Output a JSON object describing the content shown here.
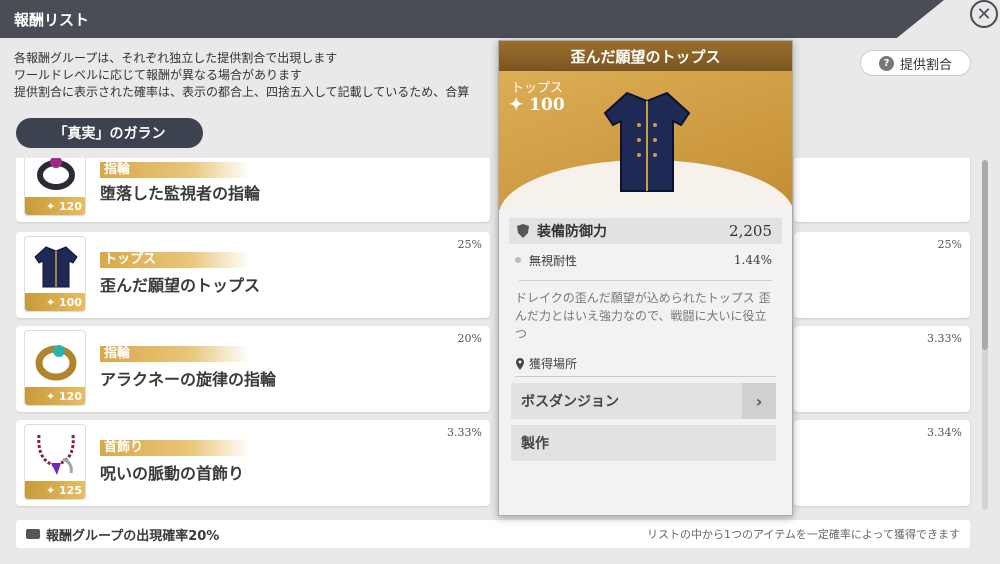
{
  "header": {
    "title": "報酬リスト"
  },
  "notice": {
    "line1": "各報酬グループは、それぞれ独立した提供割合で出現します",
    "line2": "ワールドレベルに応じて報酬が異なる場合があります",
    "line3": "提供割合に表示された確率は、表示の都合上、四捨五入して記載しているため、合算"
  },
  "rate_button": {
    "label": "提供割合",
    "icon": "?"
  },
  "group": {
    "label": "「真実」のガラン"
  },
  "items": [
    {
      "category": "指輪",
      "name": "堕落した監視者の指輪",
      "level": "✦ 120",
      "pct": ""
    },
    {
      "category": "トップス",
      "name": "歪んだ願望のトップス",
      "level": "✦ 100",
      "pct": "25%"
    },
    {
      "category": "指輪",
      "name": "アラクネーの旋律の指輪",
      "level": "✦ 120",
      "pct": "20%"
    },
    {
      "category": "首飾り",
      "name": "呪いの脈動の首飾り",
      "level": "✦ 125",
      "pct": "3.33%"
    }
  ],
  "right_pcts": [
    "25%",
    "3.33%",
    "3.34%"
  ],
  "footer": {
    "left": "報酬グループの出現確率20%",
    "right": "リストの中から1つのアイテムを一定確率によって獲得できます"
  },
  "popup": {
    "title": "歪んだ願望のトップス",
    "type": "トップス",
    "level": "✦ 100",
    "stat_main_label": "装備防御力",
    "stat_main_value": "2,205",
    "stat_sub_label": "無視耐性",
    "stat_sub_value": "1.44%",
    "desc": "ドレイクの歪んだ願望が込められたトップス 歪んだ力とはいえ強力なので、戦闘に大いに役立つ",
    "source_heading": "獲得場所",
    "sources": [
      "ボスダンジョン",
      "製作"
    ]
  },
  "colors": {
    "gold": "#d8a84a",
    "dark": "#4a4d55",
    "pill": "#3d4250"
  }
}
